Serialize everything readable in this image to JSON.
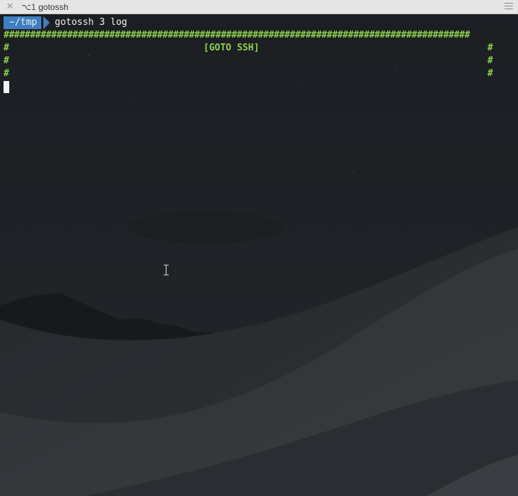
{
  "window": {
    "close_glyph": "✕",
    "tab_shortcut": "⌥1",
    "tab_title": "gotossh"
  },
  "prompt": {
    "directory": "~/tmp",
    "command": "gotossh 3 log"
  },
  "banner": {
    "border_char": "#",
    "title": "[GOTO SSH]",
    "color": "#8fd14f"
  },
  "icons": {
    "close": "close-icon",
    "menu": "hamburger-menu-icon",
    "cursor": "text-ibeam-cursor-icon"
  },
  "colors": {
    "prompt_bg": "#3f7fc0",
    "terminal_fg": "#e8e8e8",
    "background": "#1e2124"
  }
}
